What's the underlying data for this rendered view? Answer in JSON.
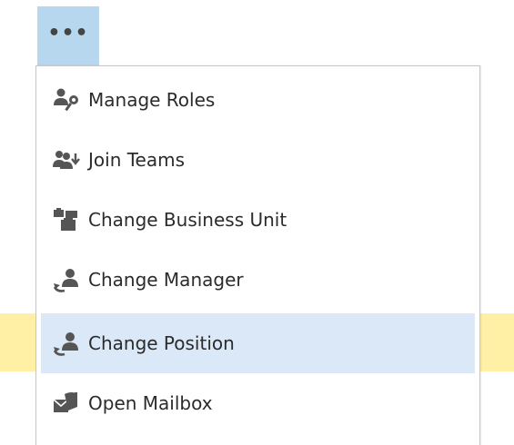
{
  "more_button": {
    "label": "•••"
  },
  "menu": {
    "items": [
      {
        "label": "Manage Roles",
        "icon": "manage-roles-icon"
      },
      {
        "label": "Join Teams",
        "icon": "join-teams-icon"
      },
      {
        "label": "Change Business Unit",
        "icon": "business-unit-icon"
      },
      {
        "label": "Change Manager",
        "icon": "change-manager-icon"
      },
      {
        "label": "Change Position",
        "icon": "change-position-icon",
        "highlighted": true
      },
      {
        "label": "Open Mailbox",
        "icon": "mailbox-icon"
      }
    ]
  },
  "colors": {
    "button_bg": "#b7d7ee",
    "hover_bg": "#dbe8f7",
    "notice_bg": "#fff0a6",
    "icon_gray": "#555555"
  }
}
